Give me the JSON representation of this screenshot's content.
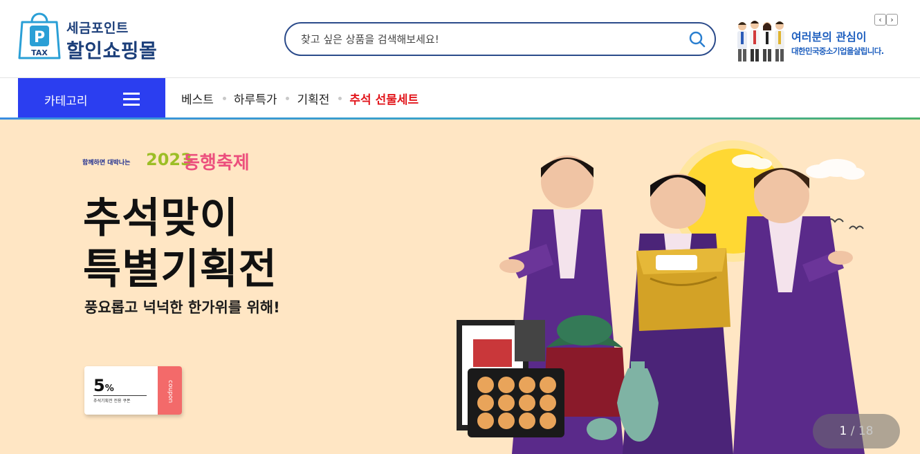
{
  "header": {
    "logo": {
      "line1": "세금포인트",
      "line2": "할인쇼핑몰",
      "badge_letter": "P",
      "badge_text": "TAX"
    },
    "search": {
      "placeholder": "찾고 싶은 상품을 검색해보세요!",
      "icon": "search-icon"
    },
    "promo": {
      "line1": "여러분의 관심이",
      "line2": "대한민국중소기업을살립니다.",
      "prev_icon": "chevron-left-icon",
      "next_icon": "chevron-right-icon"
    }
  },
  "nav": {
    "category_label": "카테고리",
    "category_icon": "hamburger-icon",
    "items": [
      {
        "label": "베스트"
      },
      {
        "label": "하루특가"
      },
      {
        "label": "기획전"
      },
      {
        "label": "추석 선물세트"
      }
    ]
  },
  "banner": {
    "fest_small": "함께하면 대박나는",
    "fest_year": "2023",
    "fest_name": "동행축제",
    "title_line1": "추석맞이",
    "title_line2": "특별기획전",
    "subtitle": "풍요롭고 넉넉한 한가위를 위해!",
    "coupon": {
      "percent": "5",
      "percent_sign": "%",
      "desc": "추석기획전 전용 쿠폰",
      "tab": "coupon"
    },
    "slide_current": "1",
    "slide_separator": " / ",
    "slide_total": "18"
  },
  "colors": {
    "brand_navy": "#1c3f7a",
    "category_blue": "#2b3ef0",
    "highlight_red": "#e2171d",
    "banner_bg": "#ffe6c4",
    "fest_green": "#9cbe26",
    "fest_pink": "#ec4f7d",
    "coupon_red": "#f36a6a"
  }
}
